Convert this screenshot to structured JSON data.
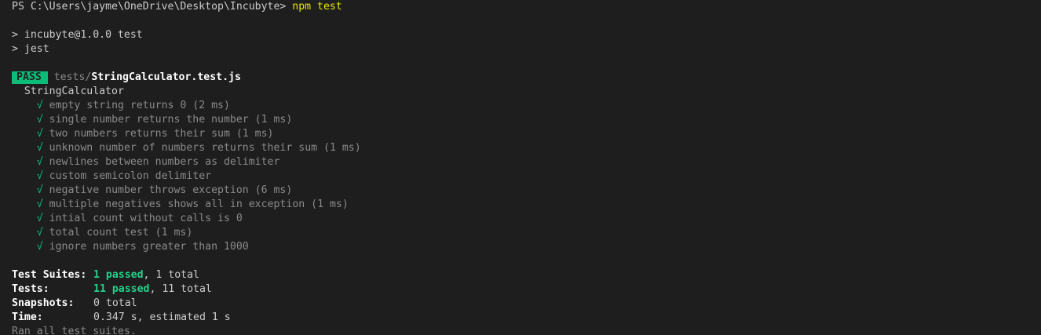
{
  "prompt": {
    "path": "PS C:\\Users\\jayme\\OneDrive\\Desktop\\Incubyte> ",
    "command": "npm test"
  },
  "script_lines": [
    "> incubyte@1.0.0 test",
    "> jest"
  ],
  "result": {
    "badge": "PASS",
    "file_dir": "tests/",
    "file_name": "StringCalculator.test.js"
  },
  "suite": {
    "name": "StringCalculator",
    "check_glyph": "√",
    "tests": [
      "empty string returns 0 (2 ms)",
      "single number returns the number (1 ms)",
      "two numbers returns their sum (1 ms)",
      "unknown number of numbers returns their sum (1 ms)",
      "newlines between numbers as delimiter",
      "custom semicolon delimiter",
      "negative number throws exception (6 ms)",
      "multiple negatives shows all in exception (1 ms)",
      "intial count without calls is 0",
      "total count test (1 ms)",
      "ignore numbers greater than 1000"
    ]
  },
  "summary": {
    "suites_label": "Test Suites:",
    "suites_passed": "1 passed",
    "suites_total": ", 1 total",
    "tests_label": "Tests:",
    "tests_passed": "11 passed",
    "tests_total": ", 11 total",
    "snapshots_label": "Snapshots:",
    "snapshots_value": "0 total",
    "time_label": "Time:",
    "time_value": "0.347 s, estimated 1 s",
    "ran_all": "Ran all test suites."
  },
  "colors": {
    "background": "#1e1e1e",
    "text": "#cccccc",
    "pass_green": "#0dbc79",
    "command_yellow": "#e5e510"
  }
}
